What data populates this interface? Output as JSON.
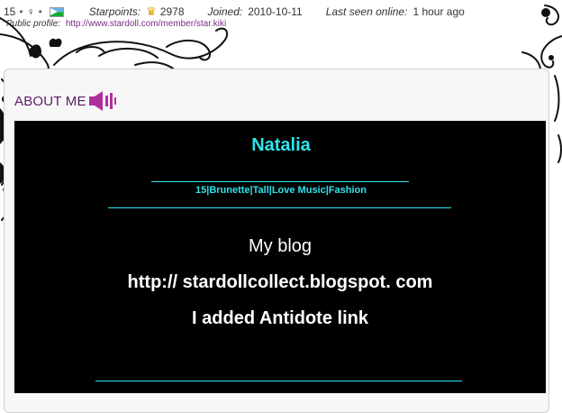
{
  "profile_bar": {
    "level": "15",
    "separator": "•",
    "gender_symbol": "♀",
    "starpoints_label": "Starpoints:",
    "starpoints_value": "2978",
    "joined_label": "Joined:",
    "joined_value": "2010-10-11",
    "last_seen_label": "Last seen online:",
    "last_seen_value": "1 hour ago",
    "public_profile_label": "Public profile:",
    "public_profile_url": "http://www.stardoll.com/member/star.kiki"
  },
  "about": {
    "title": "ABOUT ME",
    "speaker_icon": "speaker-icon",
    "name": "Natalia",
    "tags": "15|Brunette|Tall|Love Music|Fashion",
    "line1": "My blog",
    "line2": "http:// stardollcollect.blogspot. com",
    "line3": "I added Antidote link"
  },
  "colors": {
    "accent_cyan": "#2de4ec",
    "title_purple": "#5a1d63",
    "speaker_purple": "#b0309b"
  }
}
